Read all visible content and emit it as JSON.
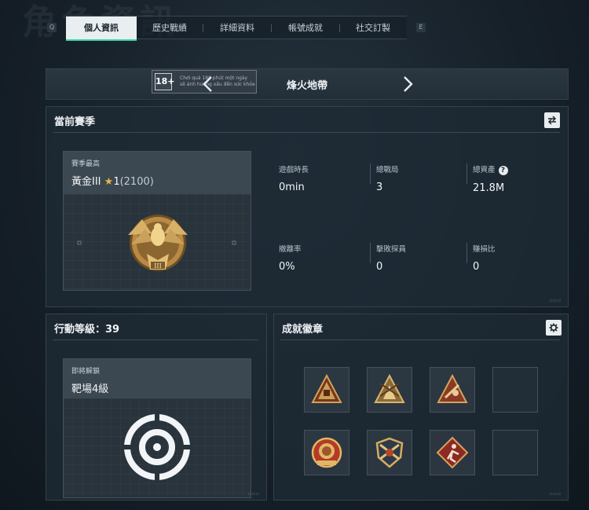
{
  "background_title": "角色資訊",
  "tabs": {
    "left_key": "Q",
    "right_key": "E",
    "items": [
      {
        "label": "個人資訊",
        "active": true
      },
      {
        "label": "歷史戰績",
        "active": false
      },
      {
        "label": "詳細資料",
        "active": false
      },
      {
        "label": "帳號成就",
        "active": false
      },
      {
        "label": "社交訂製",
        "active": false
      }
    ]
  },
  "mode": {
    "title": "烽火地帶",
    "age_rating": "18+",
    "age_notice_line1": "Chơi quá 180 phút một ngày",
    "age_notice_line2": "sẽ ảnh hưởng xấu đến sức khỏe"
  },
  "season": {
    "title": "當前賽季",
    "best_label": "賽季最高",
    "rank_name": "黃金III",
    "rank_stars": "1",
    "rank_points": "(2100)",
    "emblem_tier": "III",
    "stats": [
      {
        "label": "遊戲時長",
        "value": "0min"
      },
      {
        "label": "總戰局",
        "value": "3"
      },
      {
        "label": "總資產",
        "value": "21.8M",
        "help": "?"
      },
      {
        "label": "撤離率",
        "value": "0%"
      },
      {
        "label": "擊敗探員",
        "value": "0"
      },
      {
        "label": "賺損比",
        "value": "0"
      }
    ]
  },
  "level": {
    "title_prefix": "行動等級：",
    "level_value": "39",
    "unlock_label": "即將解鎖",
    "unlock_value": "靶場4級"
  },
  "achievements": {
    "title": "成就徽章",
    "badges": [
      {
        "icon": "gold-triangle-badge-icon",
        "empty": false
      },
      {
        "icon": "gold-triangle-soldier-badge-icon",
        "empty": false
      },
      {
        "icon": "red-triangle-badge-icon",
        "empty": false
      },
      {
        "icon": "empty-badge-slot",
        "empty": true
      },
      {
        "icon": "lion-round-badge-icon",
        "empty": false
      },
      {
        "icon": "crossed-rifles-shield-badge-icon",
        "empty": false
      },
      {
        "icon": "red-diamond-runner-badge-icon",
        "empty": false
      },
      {
        "icon": "empty-badge-slot",
        "empty": true
      }
    ]
  },
  "colors": {
    "accent": "#3ad6a2",
    "gold": "#c9a054",
    "badge_red": "#a8322b"
  }
}
